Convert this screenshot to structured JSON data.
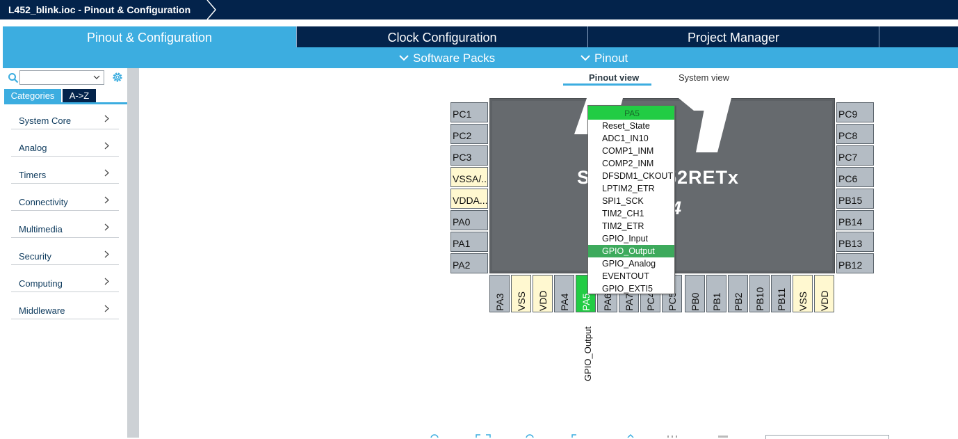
{
  "breadcrumb": {
    "title": "L452_blink.ioc - Pinout & Configuration"
  },
  "tabs": [
    {
      "label": "Pinout & Configuration"
    },
    {
      "label": "Clock Configuration"
    },
    {
      "label": "Project Manager"
    }
  ],
  "subbar": {
    "software_packs": "Software Packs",
    "pinout": "Pinout"
  },
  "left_panel": {
    "search_value": "",
    "tab_categories": "Categories",
    "tab_az": "A->Z",
    "categories": [
      {
        "label": "System Core"
      },
      {
        "label": "Analog"
      },
      {
        "label": "Timers"
      },
      {
        "label": "Connectivity"
      },
      {
        "label": "Multimedia"
      },
      {
        "label": "Security"
      },
      {
        "label": "Computing"
      },
      {
        "label": "Middleware"
      }
    ]
  },
  "view_tabs": {
    "pinout": "Pinout view",
    "system": "System view"
  },
  "chip": {
    "part_line1": "S",
    "part_line1b": "52RETx",
    "part_line2": "P64"
  },
  "pins": {
    "left": [
      "PC1",
      "PC2",
      "PC3",
      "VSSA/...",
      "VDDA...",
      "PA0",
      "PA1",
      "PA2"
    ],
    "right": [
      "PC9",
      "PC8",
      "PC7",
      "PC6",
      "PB15",
      "PB14",
      "PB13",
      "PB12"
    ],
    "bottom": [
      "PA3",
      "VSS",
      "VDD",
      "PA4",
      "PA5",
      "PA6",
      "PA7",
      "PC4",
      "PC5",
      "PB0",
      "PB1",
      "PB2",
      "PB10",
      "PB11",
      "VSS",
      "VDD"
    ]
  },
  "pin_signal_label": "GPIO_Output",
  "pin_menu": {
    "header": "PA5",
    "items": [
      "Reset_State",
      "ADC1_IN10",
      "COMP1_INM",
      "COMP2_INM",
      "DFSDM1_CKOUT",
      "LPTIM2_ETR",
      "SPI1_SCK",
      "TIM2_CH1",
      "TIM2_ETR",
      "GPIO_Input",
      "GPIO_Output",
      "GPIO_Analog",
      "EVENTOUT",
      "GPIO_EXTI5"
    ],
    "selected": "GPIO_Output"
  },
  "colors": {
    "navy": "#03234b",
    "accent_blue": "#3cade0",
    "selected_green": "#22cc44",
    "menu_selected": "#3daa5c",
    "power_pin": "#fff8d0",
    "pin_gray": "#b4bcc4"
  }
}
